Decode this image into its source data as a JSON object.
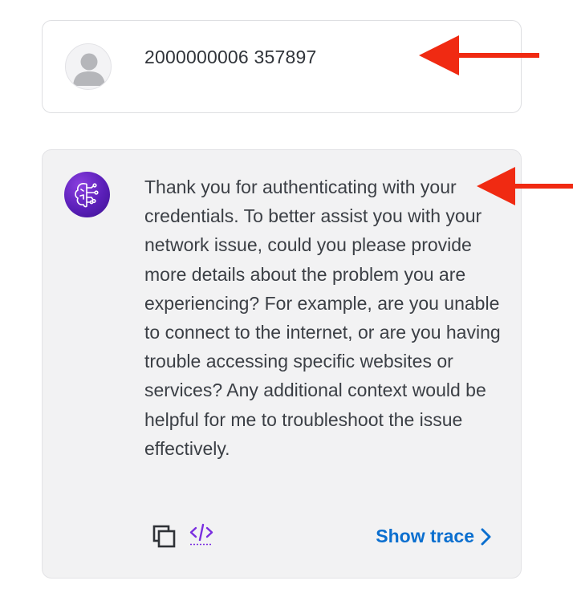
{
  "messages": {
    "user": {
      "text": "2000000006 357897",
      "avatar_icon": "person-avatar-icon"
    },
    "assistant": {
      "text": "Thank you for authenticating with your credentials. To better assist you with your network issue, could you please provide more details about the problem you are experiencing? For example, are you unable to connect to the internet, or are you having trouble accessing specific websites or services? Any additional context would be helpful for me to troubleshoot the issue effectively.",
      "avatar_icon": "ai-brain-icon",
      "actions": {
        "copy_icon": "copy-icon",
        "code_icon": "code-icon",
        "show_trace_label": "Show trace",
        "show_trace_icon": "chevron-right-icon"
      }
    }
  },
  "annotations": {
    "arrow_color": "#f02a12",
    "arrow_icon": "red-arrow-icon"
  },
  "colors": {
    "accent_link": "#0b6fcf",
    "bot_avatar": "#5a1fb8",
    "code_icon": "#7a2ee0"
  }
}
